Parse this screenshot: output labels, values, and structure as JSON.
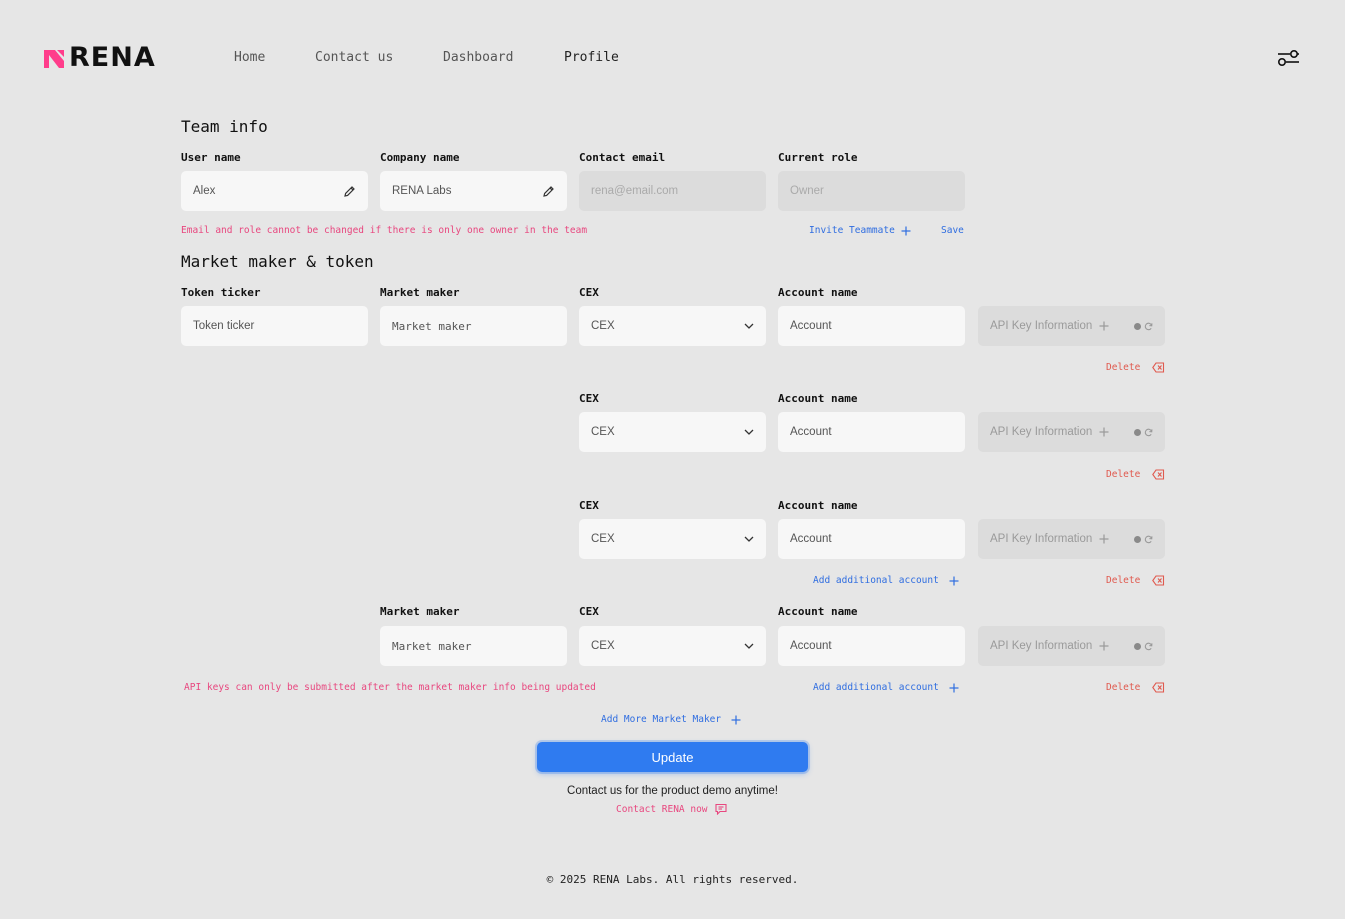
{
  "brand": {
    "name": "RENA",
    "accent_color": "#ff3d8b"
  },
  "nav": {
    "home": "Home",
    "contact": "Contact us",
    "dashboard": "Dashboard",
    "profile": "Profile"
  },
  "team_info": {
    "title": "Team info",
    "user_name_label": "User name",
    "user_name_value": "Alex",
    "company_name_label": "Company name",
    "company_name_value": "RENA Labs",
    "contact_email_label": "Contact email",
    "contact_email_placeholder": "rena@email.com",
    "current_role_label": "Current role",
    "current_role_placeholder": "Owner",
    "note": "Email and role cannot be changed if there is only one owner in the team",
    "invite_label": "Invite Teammate",
    "save_label": "Save"
  },
  "market": {
    "title": "Market maker & token",
    "token_ticker_label": "Token ticker",
    "token_ticker_placeholder": "Token ticker",
    "market_maker_label": "Market maker",
    "market_maker_placeholder": "Market maker",
    "cex_label": "CEX",
    "cex_value": "CEX",
    "account_name_label": "Account name",
    "account_placeholder": "Account",
    "api_key_label": "API Key Information",
    "delete_label": "Delete",
    "add_account_label": "Add additional account",
    "api_note": "API keys can only be submitted after the market maker info being updated",
    "add_more_label": "Add More Market Maker"
  },
  "update_label": "Update",
  "contact_text": "Contact us for the product demo anytime!",
  "contact_link": "Contact RENA now",
  "footer": "© 2025 RENA Labs. All rights reserved."
}
